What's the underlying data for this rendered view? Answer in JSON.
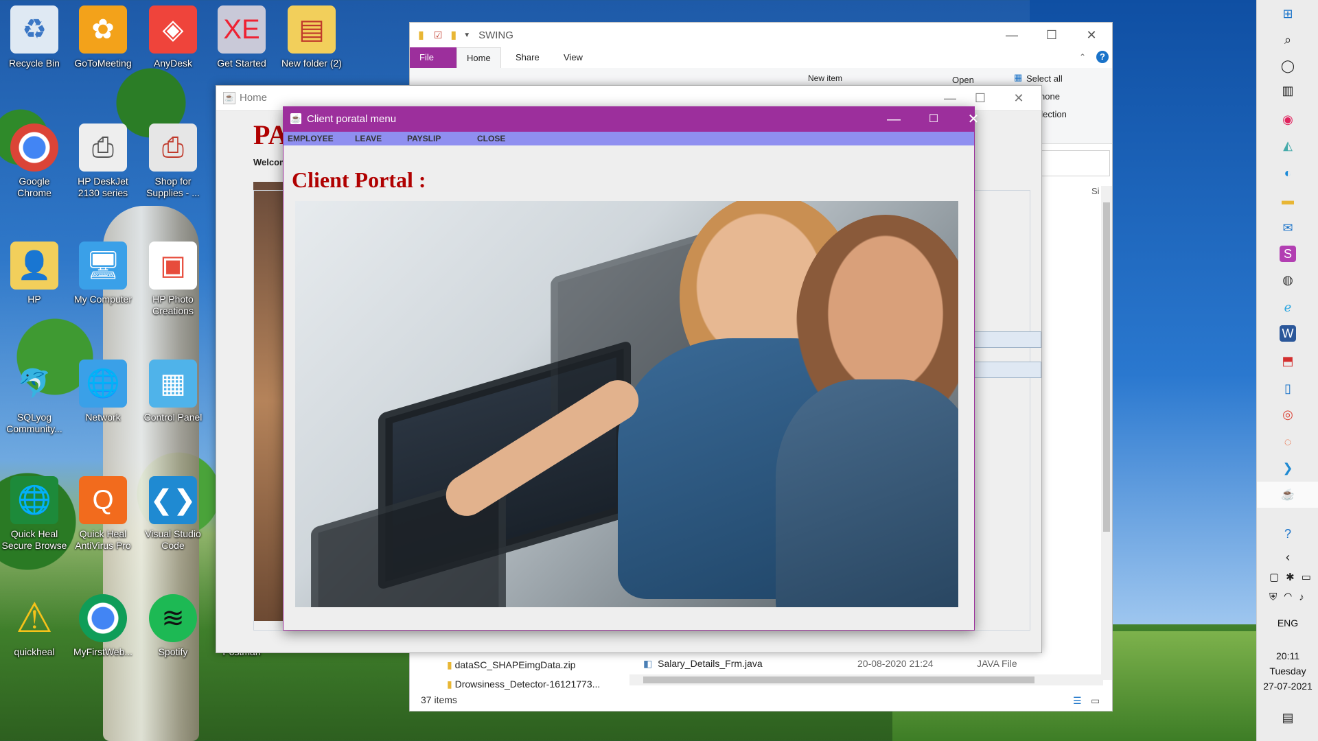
{
  "desktop": {
    "icons": [
      {
        "label": "Recycle Bin",
        "icon": "recycle-bin-icon"
      },
      {
        "label": "GoToMeeting",
        "icon": "gotomeeting-icon"
      },
      {
        "label": "AnyDesk",
        "icon": "anydesk-icon"
      },
      {
        "label": "Get Started",
        "icon": "oracle-xe-icon"
      },
      {
        "label": "New folder (2)",
        "icon": "folder-icon"
      },
      {
        "label": "Google Chrome",
        "icon": "chrome-icon"
      },
      {
        "label": "HP DeskJet 2130 series",
        "icon": "printer-icon"
      },
      {
        "label": "Shop for Supplies - ...",
        "icon": "printer-supplies-icon"
      },
      {
        "label": "HP",
        "icon": "user-folder-icon"
      },
      {
        "label": "My Computer",
        "icon": "computer-icon"
      },
      {
        "label": "HP Photo Creations",
        "icon": "photo-icon"
      },
      {
        "label": "SQLyog Community...",
        "icon": "sqlyog-icon"
      },
      {
        "label": "Network",
        "icon": "network-icon"
      },
      {
        "label": "Control Panel",
        "icon": "control-panel-icon"
      },
      {
        "label": "Quick Heal Secure Browse",
        "icon": "quickheal-browser-icon"
      },
      {
        "label": "Quick Heal AntiVirus Pro",
        "icon": "quickheal-icon"
      },
      {
        "label": "Visual Studio Code",
        "icon": "vscode-icon"
      },
      {
        "label": "quickheal",
        "icon": "warning-icon"
      },
      {
        "label": "MyFirstWeb...",
        "icon": "chrome-icon"
      },
      {
        "label": "Spotify",
        "icon": "spotify-icon"
      },
      {
        "label": "Postman",
        "icon": "postman-icon"
      }
    ]
  },
  "explorer": {
    "title": "SWING",
    "tabs": [
      "File",
      "Home",
      "Share",
      "View"
    ],
    "ribbon": {
      "open": "Open",
      "select_all": "Select all",
      "select_none": "none",
      "invert": "election",
      "new_item": "New item"
    },
    "column_size": "Si",
    "left_files": [
      "dataSC_SHAPEimgData.zip",
      "Drowsiness_Detector-16121773..."
    ],
    "file_row": {
      "name": "Salary_Details_Frm.java",
      "date": "20-08-2020 21:24",
      "type": "JAVA File"
    },
    "status": "37 items"
  },
  "home_window": {
    "title": "Home",
    "brand": "PA",
    "welcome": "Welcom"
  },
  "client_window": {
    "title": "Client poratal menu",
    "menu": [
      "EMPLOYEE",
      "LEAVE",
      "PAYSLIP",
      "CLOSE"
    ],
    "heading": "Client Portal :",
    "accent": "#9c2f9c",
    "menubar_color": "#8f8ff0",
    "heading_color": "#b00000"
  },
  "taskbar": {
    "language": "ENG",
    "time": "20:11",
    "day": "Tuesday",
    "date": "27-07-2021"
  }
}
